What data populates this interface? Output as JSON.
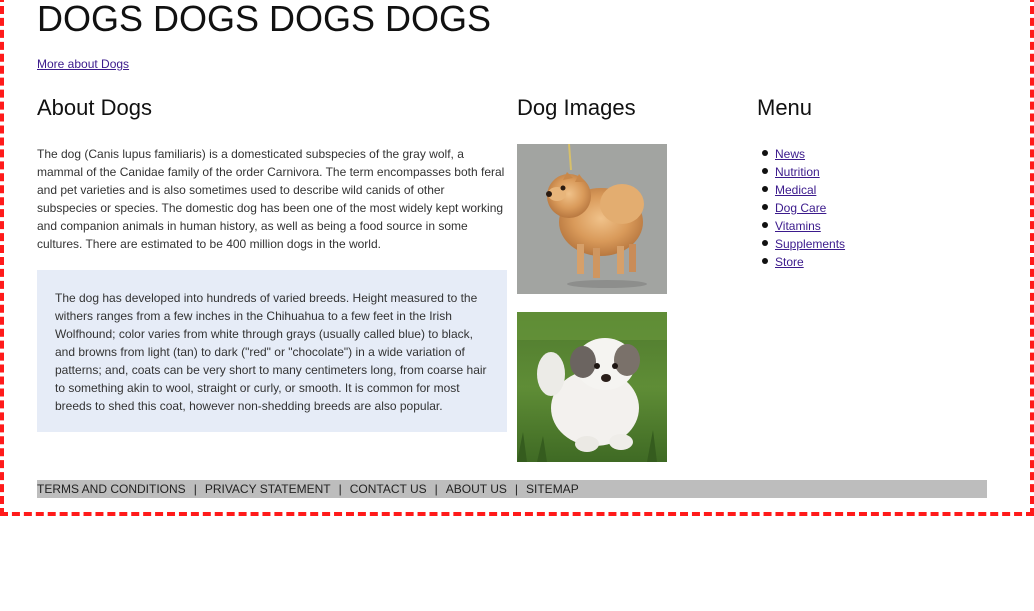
{
  "site": {
    "title": "DOGS DOGS DOGS DOGS",
    "more_link": "More about Dogs"
  },
  "about": {
    "heading": "About Dogs",
    "paragraph": "The dog (Canis lupus familiaris) is a domesticated subspecies of the gray wolf, a mammal of the Canidae family of the order Carnivora. The term encompasses both feral and pet varieties and is also sometimes used to describe wild canids of other subspecies or species. The domestic dog has been one of the most widely kept working and companion animals in human history, as well as being a food source in some cultures. There are estimated to be 400 million dogs in the world.",
    "breeds_paragraph": "The dog has developed into hundreds of varied breeds. Height measured to the withers ranges from a few inches in the Chihuahua to a few feet in the Irish Wolfhound; color varies from white through grays (usually called blue) to black, and browns from light (tan) to dark (\"red\" or \"chocolate\") in a wide variation of patterns; and, coats can be very short to many centimeters long, from coarse hair to something akin to wool, straight or curly, or smooth. It is common for most breeds to shed this coat, however non-shedding breeds are also popular."
  },
  "images": {
    "heading": "Dog Images"
  },
  "menu": {
    "heading": "Menu",
    "items": [
      "News",
      "Nutrition",
      "Medical",
      "Dog Care",
      "Vitamins",
      "Supplements",
      "Store"
    ]
  },
  "footer": {
    "links": [
      "TERMS AND CONDITIONS",
      "PRIVACY STATEMENT",
      "CONTACT US",
      "ABOUT US",
      "SITEMAP"
    ],
    "separator": "|"
  },
  "colors": {
    "frame_border": "#ff1a1a",
    "link": "#3b1a8c",
    "box_background": "#e6ecf7",
    "footer_background": "#bdbdbd"
  }
}
